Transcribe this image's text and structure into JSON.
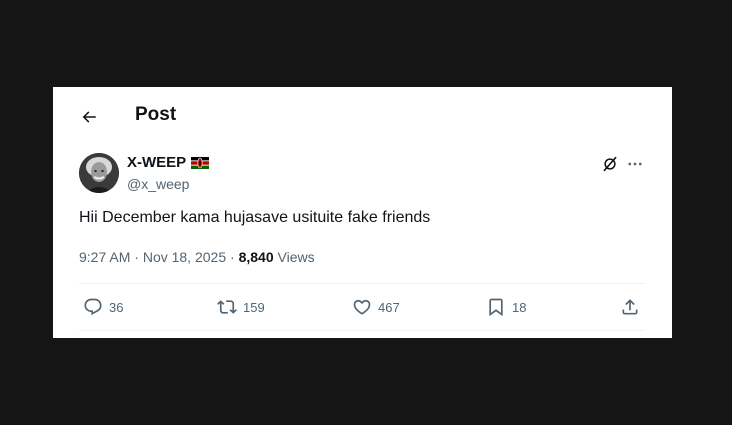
{
  "header": {
    "title": "Post",
    "back_icon": "arrow-left-icon"
  },
  "author": {
    "display_name": "X-WEEP",
    "handle": "@x_weep",
    "badge": "kenya-flag-icon"
  },
  "tweet": {
    "text": "Hii December kama hujasave usituite fake friends"
  },
  "meta": {
    "time": "9:27 AM",
    "separator1": " · ",
    "date": "Nov 18, 2025",
    "separator2": " · ",
    "views_count": "8,840",
    "views_label": " Views"
  },
  "actions": {
    "replies": "36",
    "reposts": "159",
    "likes": "467",
    "bookmarks": "18"
  },
  "colors": {
    "text_primary": "#0f1419",
    "text_secondary": "#536471",
    "divider": "#eff3f4",
    "background": "#ffffff"
  }
}
